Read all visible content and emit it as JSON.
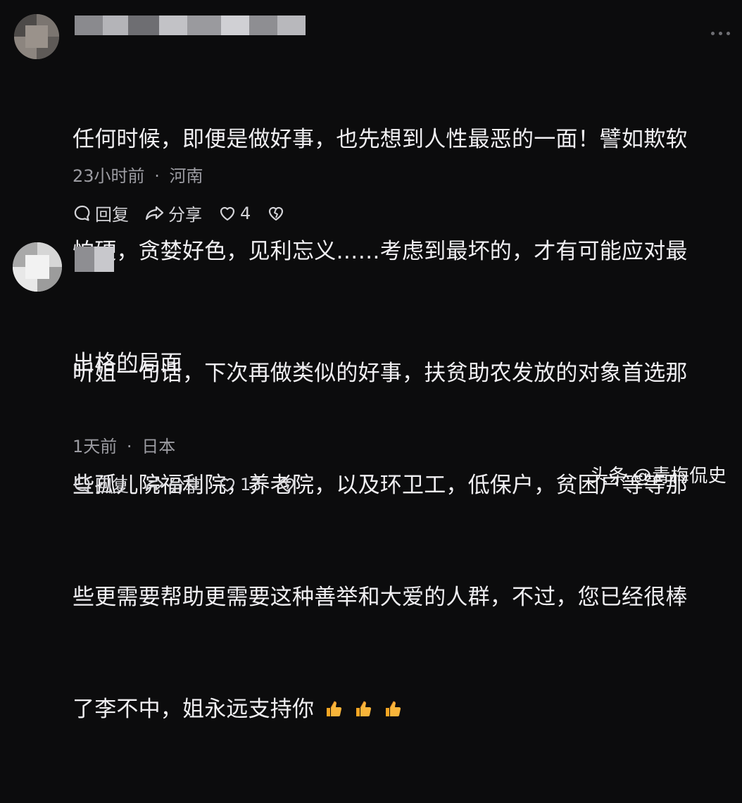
{
  "comments": [
    {
      "body_lines": [
        "任何时候，即便是做好事，也先想到人性最恶的一面！譬如欺软",
        "怕硬，贪婪好色，见利忘义……考虑到最坏的，才有可能应对最",
        "出格的局面"
      ],
      "time": "23小时前",
      "separator": "·",
      "location": "河南",
      "reply_label": "回复",
      "share_label": "分享",
      "like_count": "4"
    },
    {
      "body_lines": [
        "听姐一句话，下次再做类似的好事，扶贫助农发放的对象首选那",
        "些孤儿院福利院，养老院，以及环卫工，低保户，贫困户等等那",
        "些更需要帮助更需要这种善举和大爱的人群，不过，您已经很棒",
        "了李不中，姐永远支持你"
      ],
      "time": "1天前",
      "separator": "·",
      "location": "日本",
      "reply_label": "回复",
      "share_label": "分享",
      "like_count": "13"
    }
  ],
  "watermark": "头条 @青梅侃史",
  "icons": {
    "reply": "comment-bubble-icon",
    "share": "share-arrow-icon",
    "like": "heart-icon",
    "dislike": "broken-heart-icon",
    "more": "more-dots-icon",
    "thumbs_up": "thumbs-up-emoji"
  },
  "colors": {
    "background": "#0c0c0d",
    "text": "#f0eff2",
    "meta": "#9c9ca2",
    "thumbs": "#f5a623"
  }
}
